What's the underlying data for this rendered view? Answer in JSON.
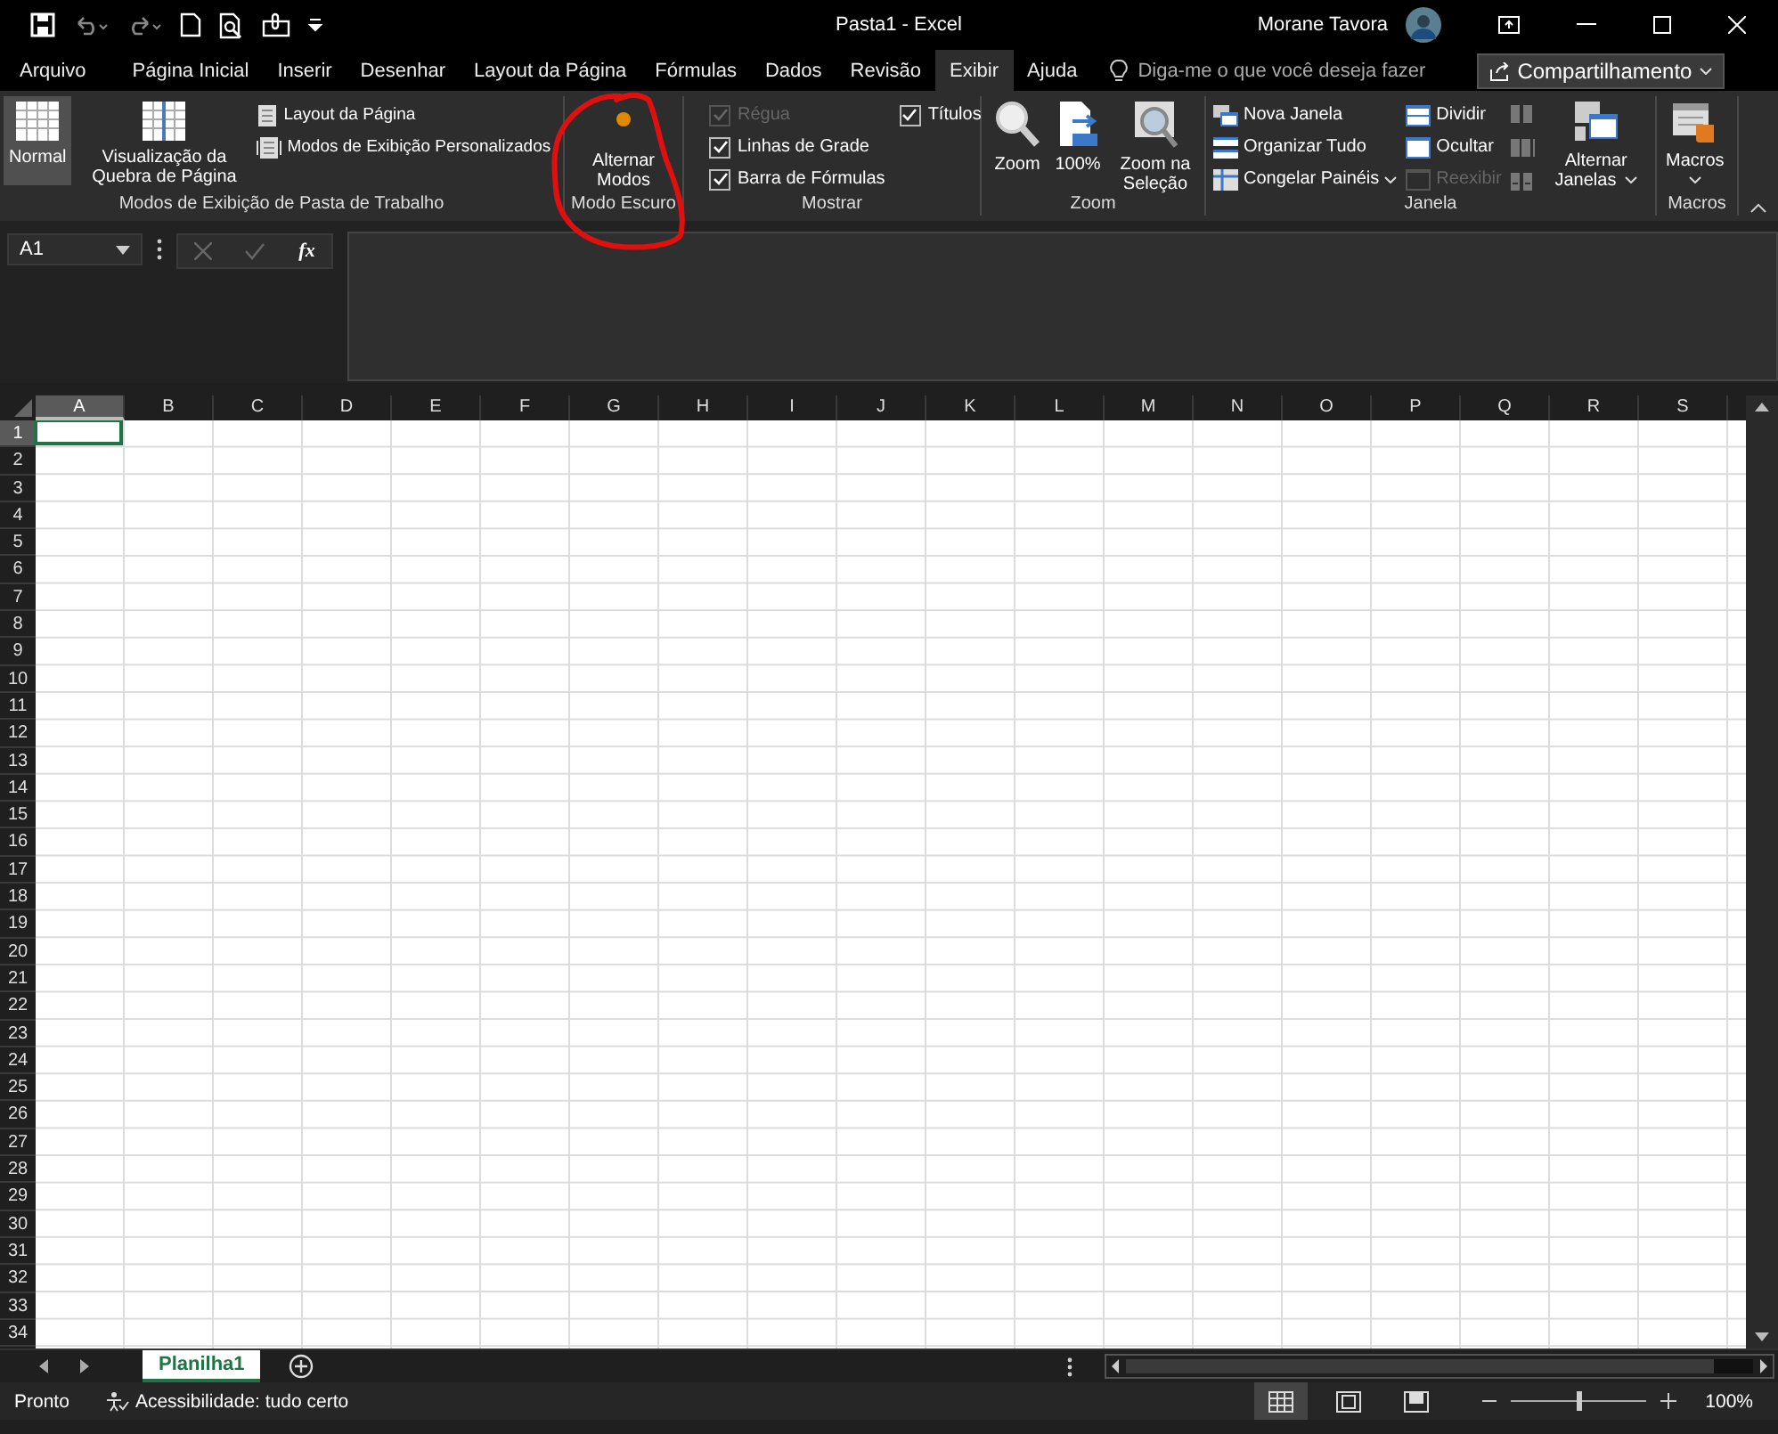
{
  "title_bar": {
    "title": "Pasta1 - Excel",
    "user": "Morane Tavora"
  },
  "tabs": [
    {
      "label": "Arquivo",
      "selected": false
    },
    {
      "label": "Página Inicial",
      "selected": false
    },
    {
      "label": "Inserir",
      "selected": false
    },
    {
      "label": "Desenhar",
      "selected": false
    },
    {
      "label": "Layout da Página",
      "selected": false
    },
    {
      "label": "Fórmulas",
      "selected": false
    },
    {
      "label": "Dados",
      "selected": false
    },
    {
      "label": "Revisão",
      "selected": false
    },
    {
      "label": "Exibir",
      "selected": true
    },
    {
      "label": "Ajuda",
      "selected": false
    }
  ],
  "tell_me": {
    "placeholder": "Diga-me o que você deseja fazer"
  },
  "share_button": {
    "label": "Compartilhamento"
  },
  "ribbon": {
    "workbook_views": {
      "label": "Modos de Exibição de Pasta de Trabalho",
      "large_buttons": [
        {
          "label": "Normal",
          "selected": true
        },
        {
          "label": "Visualização da Quebra de Página",
          "selected": false
        }
      ],
      "small_buttons": [
        "Layout da Página",
        "Modos de Exibição Personalizados"
      ]
    },
    "dark_mode": {
      "label": "Modo Escuro",
      "button": "Alternar Modos"
    },
    "show": {
      "label": "Mostrar",
      "checkboxes": [
        {
          "label": "Régua",
          "checked": true,
          "disabled": true
        },
        {
          "label": "Linhas de Grade",
          "checked": true,
          "disabled": false
        },
        {
          "label": "Barra de Fórmulas",
          "checked": true,
          "disabled": false
        },
        {
          "label": "Títulos",
          "checked": true,
          "disabled": false
        }
      ]
    },
    "zoom": {
      "label": "Zoom",
      "buttons": [
        "Zoom",
        "100%",
        "Zoom na Seleção"
      ]
    },
    "window": {
      "label": "Janela",
      "left_items": [
        "Nova Janela",
        "Organizar Tudo",
        "Congelar Painéis"
      ],
      "right_items": [
        {
          "label": "Dividir",
          "disabled": false
        },
        {
          "label": "Ocultar",
          "disabled": false
        },
        {
          "label": "Reexibir",
          "disabled": true
        }
      ],
      "switch_button": "Alternar Janelas"
    },
    "macros": {
      "label": "Macros",
      "button": "Macros"
    }
  },
  "formula_bar": {
    "name_box": "A1",
    "function_label": "fx"
  },
  "grid": {
    "columns": [
      {
        "label": "A",
        "selected": true
      },
      {
        "label": "B",
        "selected": false
      },
      {
        "label": "C",
        "selected": false
      },
      {
        "label": "D",
        "selected": false
      },
      {
        "label": "E",
        "selected": false
      },
      {
        "label": "F",
        "selected": false
      },
      {
        "label": "G",
        "selected": false
      },
      {
        "label": "H",
        "selected": false
      },
      {
        "label": "I",
        "selected": false
      },
      {
        "label": "J",
        "selected": false
      },
      {
        "label": "K",
        "selected": false
      },
      {
        "label": "L",
        "selected": false
      },
      {
        "label": "M",
        "selected": false
      },
      {
        "label": "N",
        "selected": false
      },
      {
        "label": "O",
        "selected": false
      },
      {
        "label": "P",
        "selected": false
      },
      {
        "label": "Q",
        "selected": false
      },
      {
        "label": "R",
        "selected": false
      },
      {
        "label": "S",
        "selected": false
      }
    ],
    "rows": [
      {
        "label": "1",
        "selected": true
      },
      {
        "label": "2",
        "selected": false
      },
      {
        "label": "3",
        "selected": false
      },
      {
        "label": "4",
        "selected": false
      },
      {
        "label": "5",
        "selected": false
      },
      {
        "label": "6",
        "selected": false
      },
      {
        "label": "7",
        "selected": false
      },
      {
        "label": "8",
        "selected": false
      },
      {
        "label": "9",
        "selected": false
      },
      {
        "label": "10",
        "selected": false
      },
      {
        "label": "11",
        "selected": false
      },
      {
        "label": "12",
        "selected": false
      },
      {
        "label": "13",
        "selected": false
      },
      {
        "label": "14",
        "selected": false
      },
      {
        "label": "15",
        "selected": false
      },
      {
        "label": "16",
        "selected": false
      },
      {
        "label": "17",
        "selected": false
      },
      {
        "label": "18",
        "selected": false
      },
      {
        "label": "19",
        "selected": false
      },
      {
        "label": "20",
        "selected": false
      },
      {
        "label": "21",
        "selected": false
      },
      {
        "label": "22",
        "selected": false
      },
      {
        "label": "23",
        "selected": false
      },
      {
        "label": "24",
        "selected": false
      },
      {
        "label": "25",
        "selected": false
      },
      {
        "label": "26",
        "selected": false
      },
      {
        "label": "27",
        "selected": false
      },
      {
        "label": "28",
        "selected": false
      },
      {
        "label": "29",
        "selected": false
      },
      {
        "label": "30",
        "selected": false
      },
      {
        "label": "31",
        "selected": false
      },
      {
        "label": "32",
        "selected": false
      },
      {
        "label": "33",
        "selected": false
      },
      {
        "label": "34",
        "selected": false
      }
    ]
  },
  "sheet_tabs": [
    {
      "label": "Planilha1",
      "selected": true
    }
  ],
  "status_bar": {
    "status": "Pronto",
    "accessibility": "Acessibilidade: tudo certo",
    "views": [
      {
        "kind": "normal",
        "selected": true
      },
      {
        "kind": "page_layout",
        "selected": false
      },
      {
        "kind": "page_break",
        "selected": false
      }
    ],
    "zoom": {
      "level": 0.5,
      "reading": "100%"
    }
  }
}
